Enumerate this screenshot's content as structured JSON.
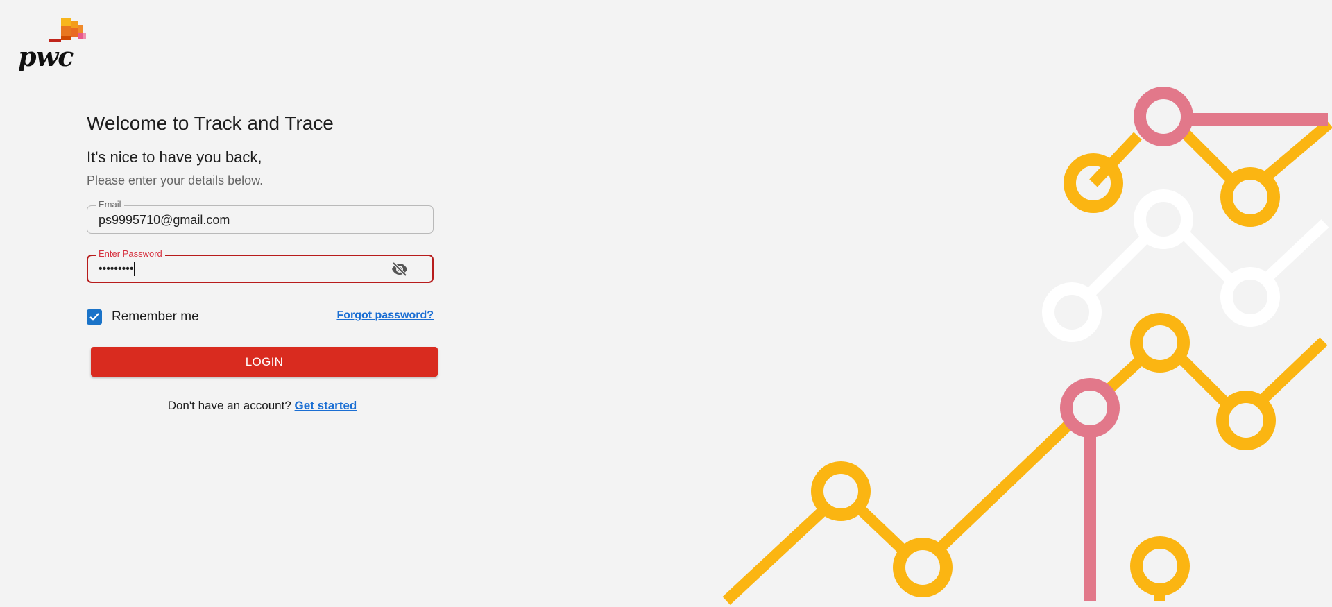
{
  "brand": {
    "name": "pwc",
    "colors": {
      "orange": "#e8a020",
      "red": "#d04a02",
      "dark_red": "#a32020",
      "pink": "#e0607e"
    }
  },
  "header": {
    "title": "Welcome to Track and Trace",
    "subtitle": "It's nice to have you back,",
    "hint": "Please enter your details below."
  },
  "form": {
    "email": {
      "label": "Email",
      "value": "ps9995710@gmail.com"
    },
    "password": {
      "label": "Enter Password",
      "value": "•••••••••",
      "toggle_icon": "eye-off-icon"
    },
    "remember": {
      "label": "Remember me",
      "checked": true
    },
    "forgot_label": "Forgot password?",
    "login_label": "LOGIN",
    "signup_prompt": "Don't have an account?",
    "signup_link": "Get started"
  },
  "theme": {
    "accent": "#d92b1f",
    "link": "#1a6ed3",
    "checkbox": "#1a73c8",
    "error": "#b71c1c",
    "art_yellow": "#fbb512",
    "art_pink": "#e2788a",
    "art_white": "#ffffff"
  }
}
